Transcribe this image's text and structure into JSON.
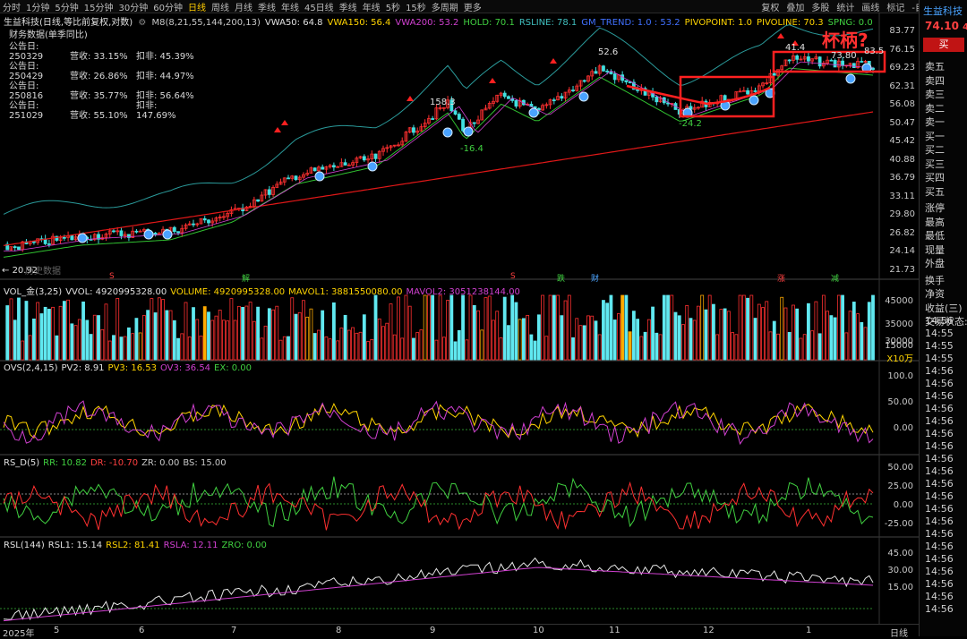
{
  "toolbar": {
    "items": [
      "分时",
      "1分钟",
      "5分钟",
      "15分钟",
      "30分钟",
      "60分钟",
      "日线",
      "周线",
      "月线",
      "季线",
      "年线",
      "45日线",
      "季线",
      "年线",
      "5秒",
      "15秒",
      "多周期",
      "更多"
    ],
    "active_index": 6,
    "right_items": [
      "复权",
      "叠加",
      "多股",
      "统计",
      "画线",
      "标记",
      "-自选",
      "返回"
    ]
  },
  "header": {
    "stock_title": "生益科技(日线,等比前复权,对数)",
    "indicators": [
      {
        "label": "M8(8,21,55,144,200,13)",
        "color": "#c8c8c8"
      },
      {
        "label": "VWA50: 64.8",
        "color": "#e0e0e0"
      },
      {
        "label": "VWA150: 56.4",
        "color": "#ffd400"
      },
      {
        "label": "VWA200: 53.2",
        "color": "#d040d0"
      },
      {
        "label": "HOLD: 70.1",
        "color": "#40d040"
      },
      {
        "label": "RSLINE: 78.1",
        "color": "#40c0c0"
      },
      {
        "label": "GM_TREND: 1.0 : 53.2",
        "color": "#4070ff"
      },
      {
        "label": "PIVOPOINT: 1.0",
        "color": "#ffd400"
      },
      {
        "label": "PIVOLINE: 70.3",
        "color": "#ffd400"
      },
      {
        "label": "SPNG: 0.0",
        "color": "#40d040"
      }
    ]
  },
  "financial": {
    "title": "财务数据(单季同比)",
    "rows": [
      {
        "date": "公告日: 250329",
        "rev": "营收: 33.15%",
        "net": "扣非: 45.39%"
      },
      {
        "date": "公告日: 250429",
        "rev": "营收: 26.86%",
        "net": "扣非: 44.97%"
      },
      {
        "date": "公告日: 250816",
        "rev": "营收: 35.77%",
        "net": "扣非: 56.64%"
      },
      {
        "date": "公告日: 251029",
        "rev": "营收: 55.10%",
        "net": "扣非: 147.69%"
      }
    ],
    "caption": "历史数据"
  },
  "annotation": {
    "text": "杯柄?",
    "color": "#ff3030"
  },
  "price_labels": {
    "high_1": "52.6",
    "high_2": "158.3",
    "low_1": "-16.4",
    "low_2": "-24.2",
    "high_3": "41.4",
    "high_4": "73.80",
    "high_5": "83.5",
    "start": "20.92"
  },
  "price_axis": [
    "83.77",
    "76.15",
    "69.23",
    "62.31",
    "56.08",
    "50.47",
    "45.42",
    "40.88",
    "36.79",
    "33.11",
    "29.80",
    "26.82",
    "24.14",
    "21.73"
  ],
  "vol": {
    "title": "VOL_金(3,25)",
    "items": [
      {
        "label": "VVOL: 4920995328.00",
        "color": "#e0e0e0"
      },
      {
        "label": "VOLUME: 4920995328.00",
        "color": "#ffd400"
      },
      {
        "label": "MAVOL1: 3881550080.00",
        "color": "#ffd400"
      },
      {
        "label": "MAVOL2: 3051238144.00",
        "color": "#d040d0"
      }
    ],
    "axis": [
      "45000",
      "35000",
      "30000",
      "15000"
    ],
    "unit": "X10万"
  },
  "ovs": {
    "title": "OVS(2,4,15)",
    "items": [
      {
        "label": "PV2: 8.91",
        "color": "#e0e0e0"
      },
      {
        "label": "PV3: 16.53",
        "color": "#ffd400"
      },
      {
        "label": "OV3: 36.54",
        "color": "#d040d0"
      },
      {
        "label": "EX: 0.00",
        "color": "#40d040"
      }
    ],
    "axis": [
      "100.0",
      "50.00",
      "0.00"
    ]
  },
  "rsd": {
    "title": "RS_D(5)",
    "items": [
      {
        "label": "RR: 10.82",
        "color": "#40d040"
      },
      {
        "label": "DR: -10.70",
        "color": "#ff4040"
      },
      {
        "label": "ZR: 0.00",
        "color": "#c8c8c8"
      },
      {
        "label": "BS: 15.00",
        "color": "#c8c8c8"
      }
    ],
    "axis": [
      "50.00",
      "25.00",
      "0.00",
      "-25.00"
    ]
  },
  "rsl": {
    "title": "RSL(144)",
    "items": [
      {
        "label": "RSL1: 15.14",
        "color": "#e0e0e0"
      },
      {
        "label": "RSL2: 81.41",
        "color": "#ffd400"
      },
      {
        "label": "RSLA: 12.11",
        "color": "#d040d0"
      },
      {
        "label": "ZRO: 0.00",
        "color": "#40d040"
      }
    ],
    "axis": [
      "45.00",
      "30.00",
      "15.00"
    ]
  },
  "months": [
    "2025年",
    "5",
    "6",
    "7",
    "8",
    "9",
    "10",
    "11",
    "12",
    "1"
  ],
  "bottom_right": "日线",
  "markers": [
    "S",
    "解",
    "S",
    "跌",
    "财",
    "涨",
    "减"
  ],
  "right_panel": {
    "name": "生益科技",
    "price": "74.10",
    "price_suffix": "4.",
    "buy": "买",
    "items": [
      "卖五",
      "卖四",
      "卖三",
      "卖二",
      "卖一",
      "买一",
      "买二",
      "买三",
      "买四",
      "买五",
      "涨停",
      "最高",
      "最低",
      "现量",
      "外盘",
      "换手",
      "净资",
      "收益(三)",
      "交易状态:"
    ],
    "times": [
      "14:56",
      "14:55",
      "14:55",
      "14:55",
      "14:56",
      "14:56",
      "14:56",
      "14:56",
      "14:56",
      "14:56",
      "14:56",
      "14:56",
      "14:56",
      "14:56",
      "14:56",
      "14:56",
      "14:56",
      "14:56",
      "14:56",
      "14:56",
      "14:56",
      "14:56",
      "14:56",
      "14:56",
      "14:57"
    ]
  }
}
